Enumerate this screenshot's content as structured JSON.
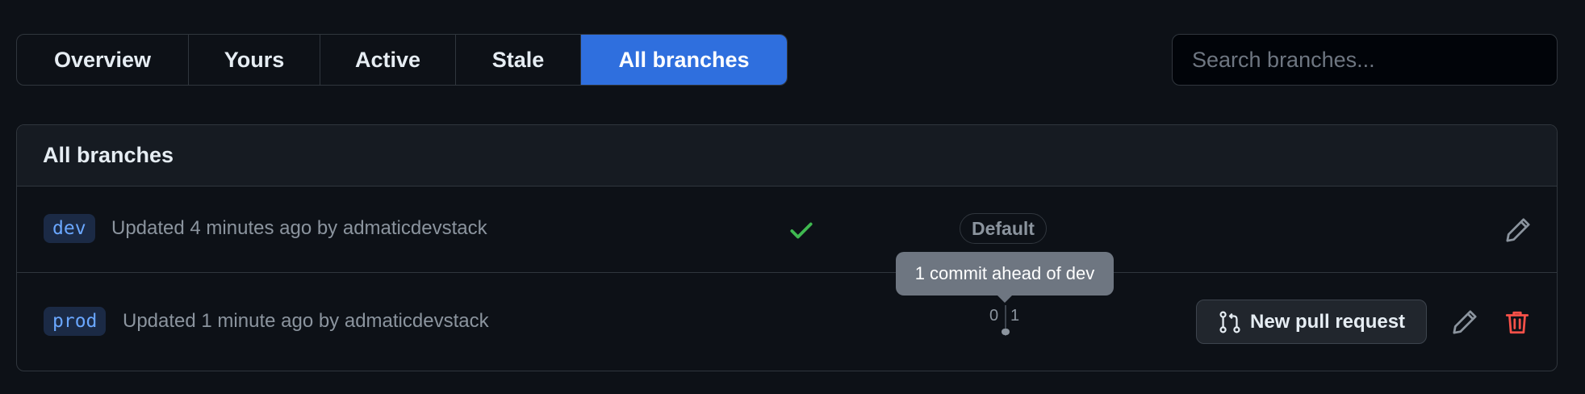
{
  "tabs": [
    {
      "label": "Overview",
      "active": false
    },
    {
      "label": "Yours",
      "active": false
    },
    {
      "label": "Active",
      "active": false
    },
    {
      "label": "Stale",
      "active": false
    },
    {
      "label": "All branches",
      "active": true
    }
  ],
  "search": {
    "placeholder": "Search branches...",
    "value": ""
  },
  "panel": {
    "title": "All branches"
  },
  "branches": [
    {
      "name": "dev",
      "updated": "Updated 4 minutes ago by admaticdevstack",
      "status_icon": "check-icon",
      "badge": "Default",
      "actions": [
        "pencil-icon"
      ]
    },
    {
      "name": "prod",
      "updated": "Updated 1 minute ago by admaticdevstack",
      "behind": "0",
      "ahead": "1",
      "tooltip": "1 commit ahead of dev",
      "pr_button": "New pull request",
      "actions": [
        "pencil-icon",
        "trash-icon"
      ]
    }
  ],
  "colors": {
    "background": "#0d1117",
    "accent": "#2f6fde",
    "branch_tag_text": "#6aa7ff",
    "success": "#3fb950",
    "danger": "#f85149"
  }
}
